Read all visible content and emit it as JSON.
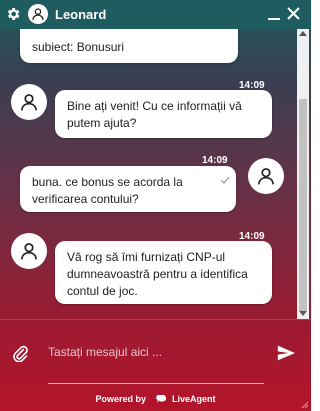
{
  "header": {
    "title": "Leonard"
  },
  "messages": [
    {
      "sender": "visitor",
      "text": "subiect: Bonusuri",
      "time": ""
    },
    {
      "sender": "agent",
      "text": "Bine ați venit! Cu ce informații vă putem ajuta?",
      "time": "14:09"
    },
    {
      "sender": "visitor",
      "text": "buna. ce bonus se acorda la verificarea contului?",
      "time": "14:09"
    },
    {
      "sender": "agent",
      "text": "Vă rog să îmi furnizați CNP-ul dumneavoastră pentru a identifica contul de joc.",
      "time": "14:09"
    }
  ],
  "input": {
    "placeholder": "Tastați mesajul aici ..."
  },
  "footer": {
    "powered_by": "Powered by",
    "brand": "LiveAgent"
  },
  "colors": {
    "header": "#1f5c5f",
    "gradient_top": "#1e5a5c",
    "gradient_bottom": "#b3142a"
  }
}
